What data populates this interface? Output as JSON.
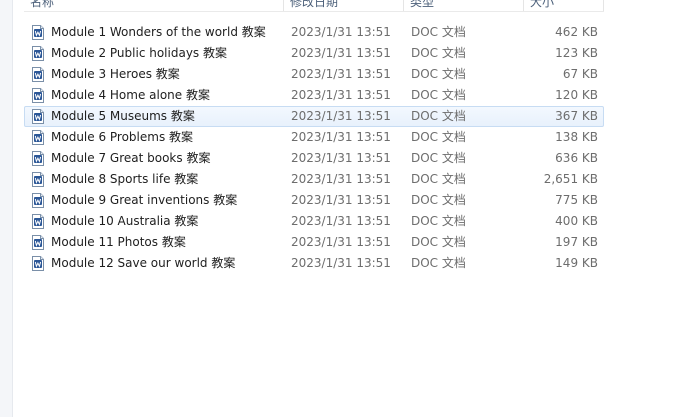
{
  "columns": {
    "name": "名称",
    "date": "修改日期",
    "type": "类型",
    "size": "大小"
  },
  "files": [
    {
      "name": "Module 1 Wonders of the world 教案",
      "date": "2023/1/31 13:51",
      "type": "DOC 文档",
      "size": "462 KB",
      "icon": "word-doc-icon"
    },
    {
      "name": "Module 2 Public holidays 教案",
      "date": "2023/1/31 13:51",
      "type": "DOC 文档",
      "size": "123 KB",
      "icon": "word-doc-icon"
    },
    {
      "name": "Module 3 Heroes 教案",
      "date": "2023/1/31 13:51",
      "type": "DOC 文档",
      "size": "67 KB",
      "icon": "word-doc-icon"
    },
    {
      "name": "Module 4 Home alone 教案",
      "date": "2023/1/31 13:51",
      "type": "DOC 文档",
      "size": "120 KB",
      "icon": "word-doc-icon"
    },
    {
      "name": "Module 5 Museums 教案",
      "date": "2023/1/31 13:51",
      "type": "DOC 文档",
      "size": "367 KB",
      "icon": "word-doc-icon",
      "selected": true
    },
    {
      "name": "Module 6 Problems 教案",
      "date": "2023/1/31 13:51",
      "type": "DOC 文档",
      "size": "138 KB",
      "icon": "word-doc-icon"
    },
    {
      "name": "Module 7 Great books 教案",
      "date": "2023/1/31 13:51",
      "type": "DOC 文档",
      "size": "636 KB",
      "icon": "word-doc-icon"
    },
    {
      "name": "Module 8 Sports life 教案",
      "date": "2023/1/31 13:51",
      "type": "DOC 文档",
      "size": "2,651 KB",
      "icon": "word-doc-icon"
    },
    {
      "name": "Module 9 Great inventions 教案",
      "date": "2023/1/31 13:51",
      "type": "DOC 文档",
      "size": "775 KB",
      "icon": "word-doc-icon"
    },
    {
      "name": "Module 10 Australia 教案",
      "date": "2023/1/31 13:51",
      "type": "DOC 文档",
      "size": "400 KB",
      "icon": "word-doc-icon"
    },
    {
      "name": "Module 11 Photos 教案",
      "date": "2023/1/31 13:51",
      "type": "DOC 文档",
      "size": "197 KB",
      "icon": "word-doc-icon"
    },
    {
      "name": "Module 12 Save our world  教案",
      "date": "2023/1/31 13:51",
      "type": "DOC 文档",
      "size": "149 KB",
      "icon": "word-doc-icon"
    }
  ],
  "colors": {
    "header_text": "#4c607a",
    "selection_border": "#c7dcf3",
    "selection_fill": "#e8f1fc",
    "doc_icon_blue": "#2b5797"
  }
}
